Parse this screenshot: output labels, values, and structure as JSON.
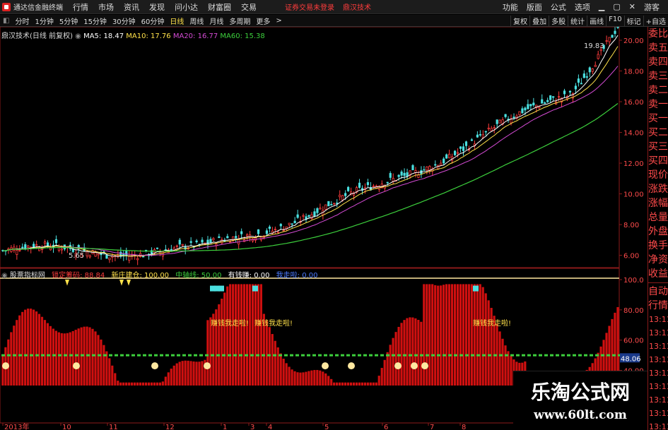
{
  "app": {
    "name": "通达信金融终端"
  },
  "menu": {
    "items": [
      "行情",
      "市场",
      "资讯",
      "发现",
      "问小达",
      "财富圈",
      "交易"
    ],
    "notice": "证券交易未登录",
    "stock_notice": "鼎汉技术",
    "right": [
      "功能",
      "版面",
      "公式",
      "选项"
    ],
    "user": "游客"
  },
  "periods": {
    "items": [
      "分时",
      "1分钟",
      "5分钟",
      "15分钟",
      "30分钟",
      "60分钟",
      "日线",
      "周线",
      "月线",
      "多周期",
      "更多"
    ],
    "active": "日线"
  },
  "toolbar": [
    "复权",
    "叠加",
    "多股",
    "统计",
    "画线",
    "F10",
    "标记",
    "+自选"
  ],
  "main": {
    "title": "鼎汉技术(日线 前复权)",
    "ma": [
      {
        "label": "MA5: 18.47",
        "color": "#ffffff"
      },
      {
        "label": "MA10: 17.76",
        "color": "#ffe14a"
      },
      {
        "label": "MA20: 16.77",
        "color": "#d44bd4"
      },
      {
        "label": "MA60: 15.38",
        "color": "#3ccf3c"
      }
    ],
    "price_axis": [
      "20.00",
      "18.00",
      "16.00",
      "14.00",
      "12.00",
      "10.00",
      "8.00",
      "6.00"
    ],
    "high_label": "19.83",
    "low_label": "5.65"
  },
  "indicator": {
    "title": "股票指标网",
    "values": [
      {
        "label": "锁定筹码:",
        "value": "88.84",
        "color": "#ff3c3c"
      },
      {
        "label": "新庄建仓:",
        "value": "100.00",
        "color": "#ffe14a"
      },
      {
        "label": "中轴线:",
        "value": "50.00",
        "color": "#3ccf3c"
      },
      {
        "label": "有钱赚:",
        "value": "0.00",
        "color": "#ffffff"
      },
      {
        "label": "我走啦:",
        "value": "0.00",
        "color": "#4b7bff"
      }
    ],
    "axis": [
      "100.0",
      "80.00",
      "60.00",
      "40.00"
    ],
    "current": "48.06",
    "annotation": "赚钱我走啦!"
  },
  "date_axis": [
    "2013年",
    "10",
    "11",
    "12",
    "1",
    "3",
    "4",
    "5",
    "6",
    "7",
    "8"
  ],
  "right_panel": {
    "items": [
      "委比",
      "卖五",
      "卖四",
      "卖三",
      "卖二",
      "卖一",
      "买一",
      "买二",
      "买三",
      "买四",
      "现价",
      "涨跌",
      "涨幅",
      "总量",
      "外盘",
      "换手",
      "净资",
      "收益"
    ],
    "bottom": [
      "自动",
      "行情"
    ],
    "times": [
      "13:11",
      "13:11",
      "13:11",
      "13:11",
      "13:11",
      "13:11",
      "13:11",
      "13:11",
      "13:11",
      "13:11"
    ]
  },
  "watermark": {
    "title": "乐淘公式网",
    "url": "www.60lt.com"
  }
}
